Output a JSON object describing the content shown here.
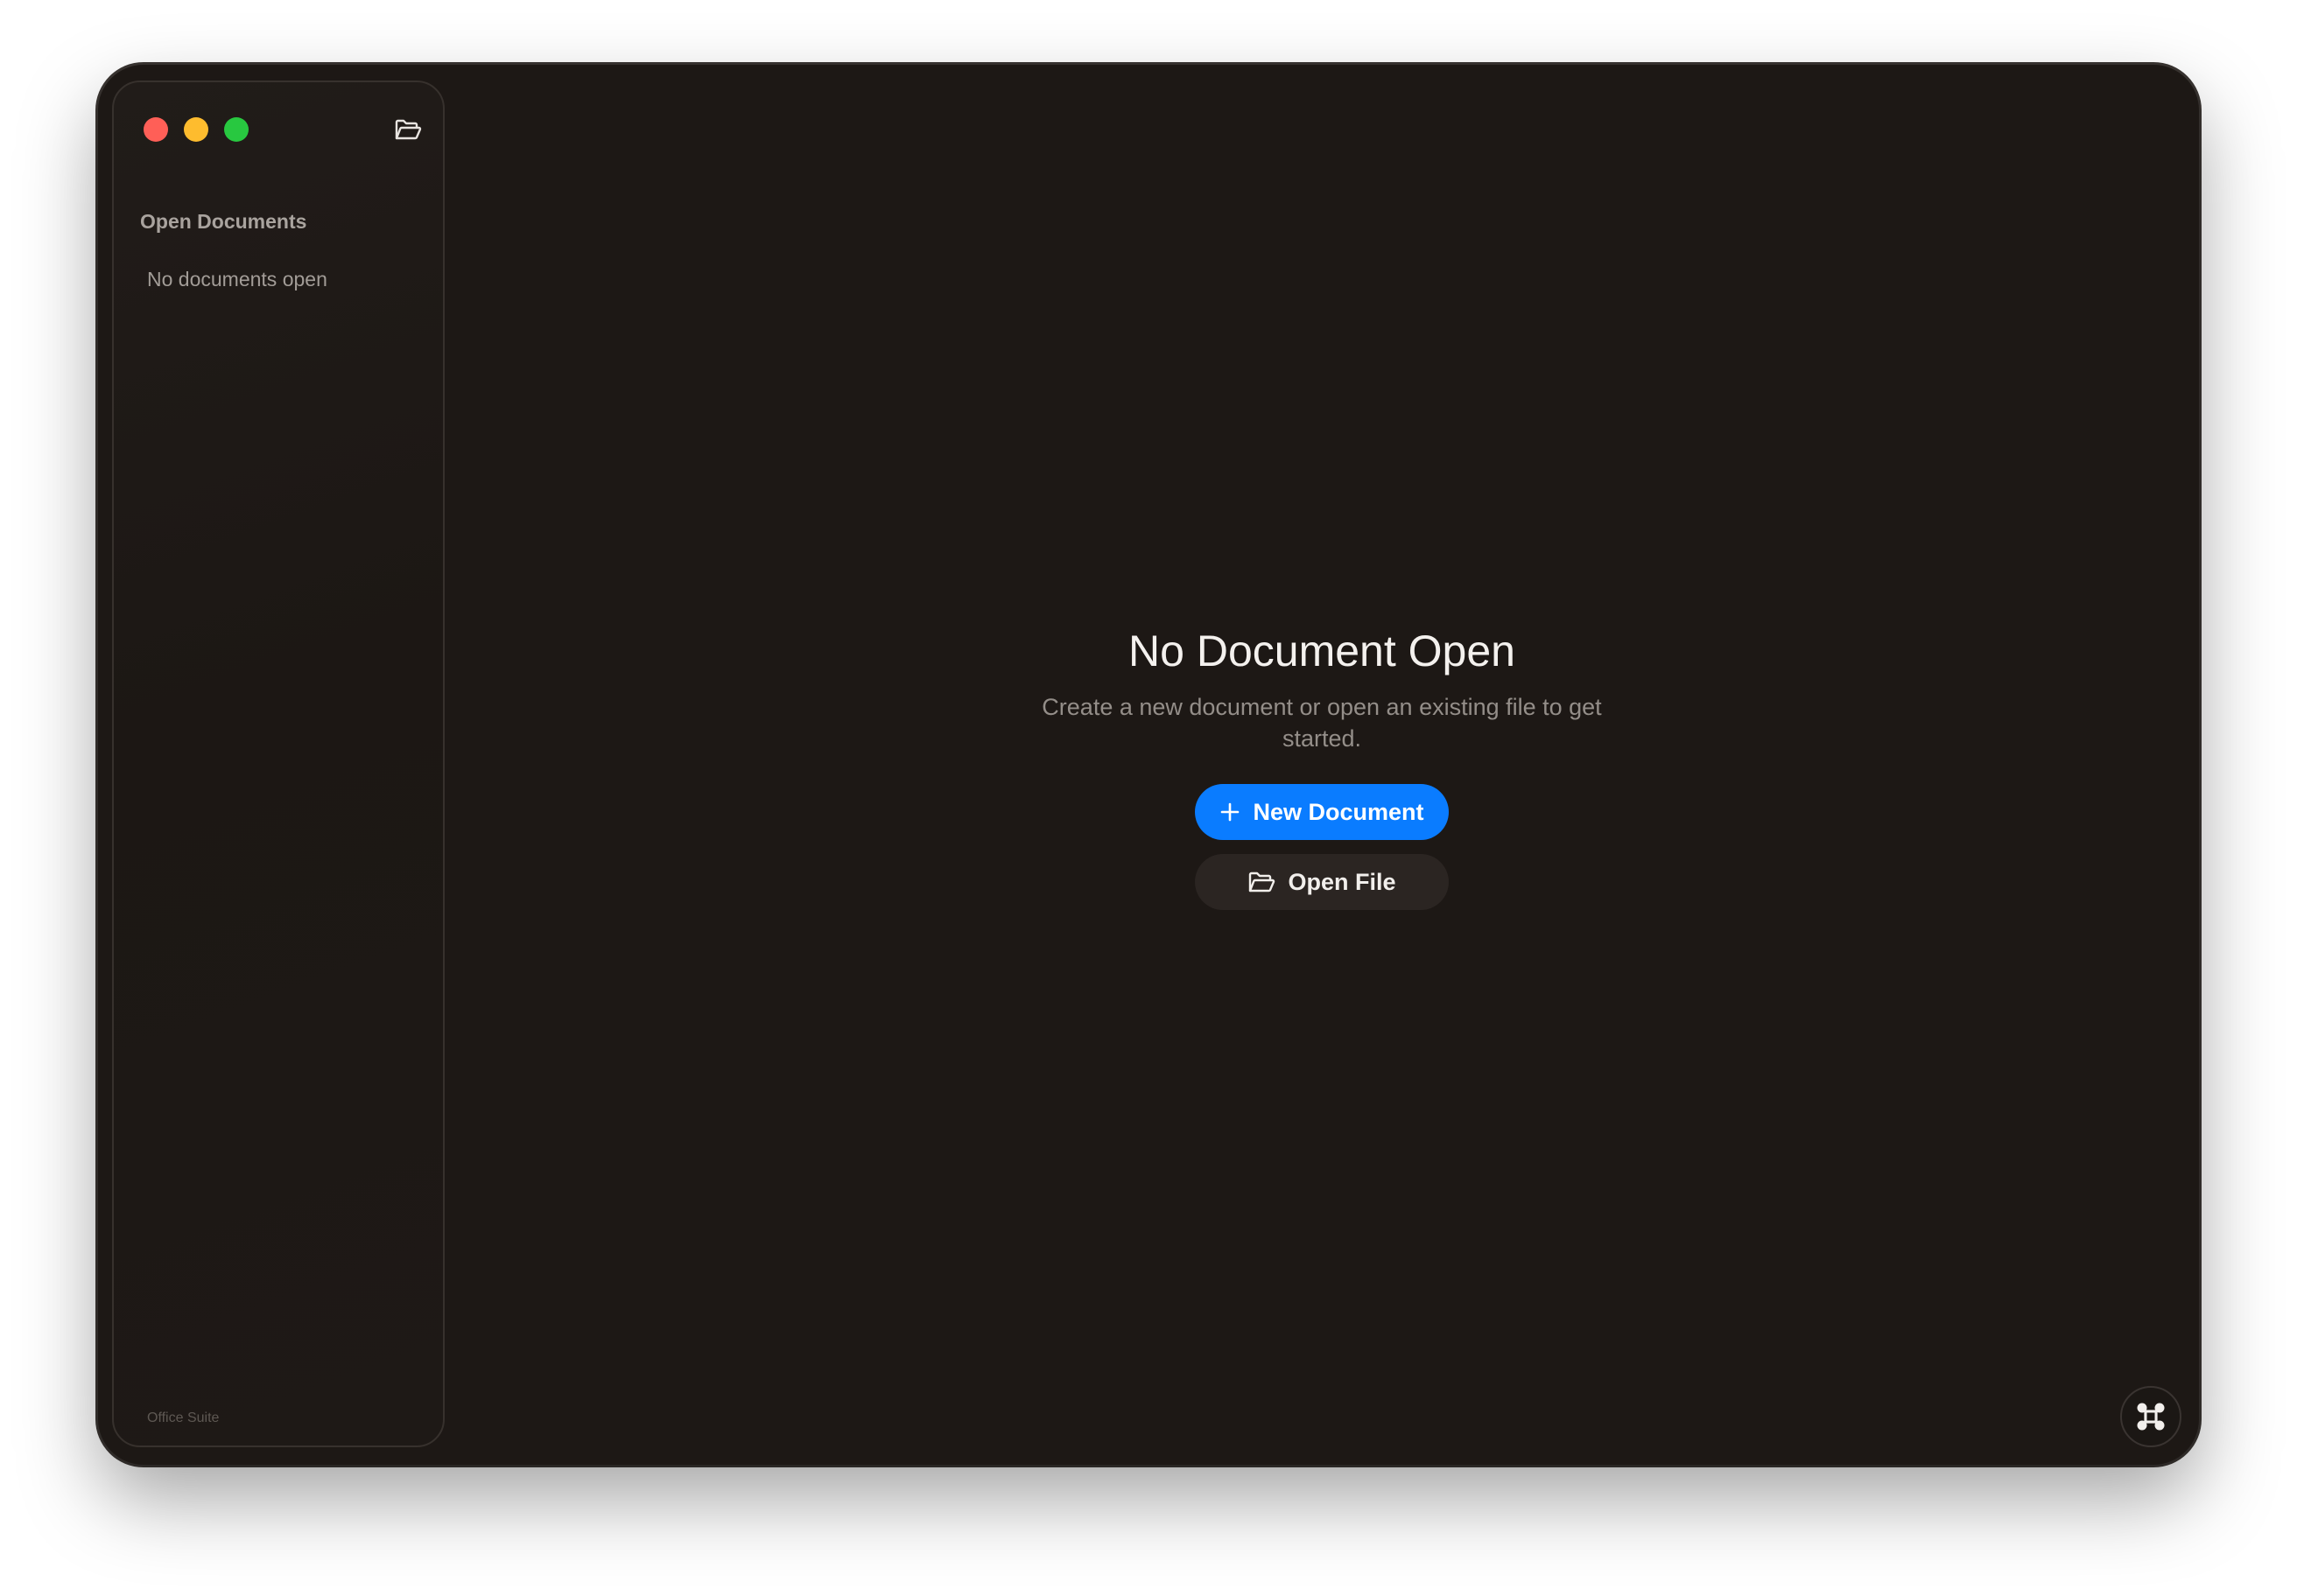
{
  "sidebar": {
    "title": "Open Documents",
    "empty_label": "No documents open",
    "footer_label": "Office Suite",
    "open_icon": "folder-open-icon"
  },
  "main": {
    "empty_title": "No Document Open",
    "empty_subtitle": "Create a new document or open an existing file to get started.",
    "new_document_label": "New Document",
    "open_file_label": "Open File"
  },
  "colors": {
    "window_bg": "#1d1815",
    "accent": "#0a7cff",
    "secondary_button": "#2b2522",
    "traffic_red": "#ff5f57",
    "traffic_yellow": "#febc2e",
    "traffic_green": "#28c840"
  },
  "icons": {
    "new_document": "plus-icon",
    "open_file": "folder-open-icon",
    "corner_button": "command-icon"
  }
}
